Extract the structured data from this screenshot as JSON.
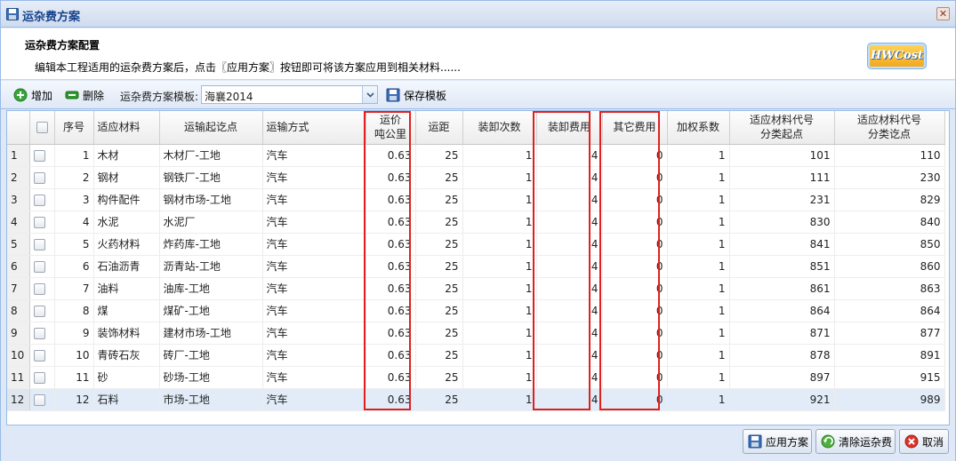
{
  "window": {
    "title": "运杂费方案",
    "close_symbol": "✕"
  },
  "header": {
    "title": "运杂费方案配置",
    "description": "编辑本工程适用的运杂费方案后，点击〖应用方案〗按钮即可将该方案应用到相关材料......",
    "logo": "HWCost"
  },
  "toolbar": {
    "add_label": "增加",
    "delete_label": "删除",
    "template_label": "运杂费方案模板:",
    "template_value": "海襄2014",
    "save_template_label": "保存模板"
  },
  "grid": {
    "columns": {
      "seq": "序号",
      "material": "适应材料",
      "route": "运输起讫点",
      "mode": "运输方式",
      "price_l1": "运价",
      "price_l2": "吨公里",
      "distance": "运距",
      "load_times": "装卸次数",
      "load_fee": "装卸费用",
      "other_fee": "其它费用",
      "weight": "加权系数",
      "code_start_l1": "适应材料代号",
      "code_start_l2": "分类起点",
      "code_end_l1": "适应材料代号",
      "code_end_l2": "分类讫点"
    },
    "rows": [
      {
        "rn": "1",
        "seq": "1",
        "material": "木材",
        "route": "木材厂-工地",
        "mode": "汽车",
        "price": "0.63",
        "distance": "25",
        "load_times": "1",
        "load_fee": "4",
        "other_fee": "0",
        "weight": "1",
        "code_start": "101",
        "code_end": "110"
      },
      {
        "rn": "2",
        "seq": "2",
        "material": "钢材",
        "route": "钢铁厂-工地",
        "mode": "汽车",
        "price": "0.63",
        "distance": "25",
        "load_times": "1",
        "load_fee": "4",
        "other_fee": "0",
        "weight": "1",
        "code_start": "111",
        "code_end": "230"
      },
      {
        "rn": "3",
        "seq": "3",
        "material": "构件配件",
        "route": "钢材市场-工地",
        "mode": "汽车",
        "price": "0.63",
        "distance": "25",
        "load_times": "1",
        "load_fee": "4",
        "other_fee": "0",
        "weight": "1",
        "code_start": "231",
        "code_end": "829"
      },
      {
        "rn": "4",
        "seq": "4",
        "material": "水泥",
        "route": "水泥厂",
        "mode": "汽车",
        "price": "0.63",
        "distance": "25",
        "load_times": "1",
        "load_fee": "4",
        "other_fee": "0",
        "weight": "1",
        "code_start": "830",
        "code_end": "840"
      },
      {
        "rn": "5",
        "seq": "5",
        "material": "火药材料",
        "route": "炸药库-工地",
        "mode": "汽车",
        "price": "0.63",
        "distance": "25",
        "load_times": "1",
        "load_fee": "4",
        "other_fee": "0",
        "weight": "1",
        "code_start": "841",
        "code_end": "850"
      },
      {
        "rn": "6",
        "seq": "6",
        "material": "石油沥青",
        "route": "沥青站-工地",
        "mode": "汽车",
        "price": "0.63",
        "distance": "25",
        "load_times": "1",
        "load_fee": "4",
        "other_fee": "0",
        "weight": "1",
        "code_start": "851",
        "code_end": "860"
      },
      {
        "rn": "7",
        "seq": "7",
        "material": "油料",
        "route": "油库-工地",
        "mode": "汽车",
        "price": "0.63",
        "distance": "25",
        "load_times": "1",
        "load_fee": "4",
        "other_fee": "0",
        "weight": "1",
        "code_start": "861",
        "code_end": "863"
      },
      {
        "rn": "8",
        "seq": "8",
        "material": "煤",
        "route": "煤矿-工地",
        "mode": "汽车",
        "price": "0.63",
        "distance": "25",
        "load_times": "1",
        "load_fee": "4",
        "other_fee": "0",
        "weight": "1",
        "code_start": "864",
        "code_end": "864"
      },
      {
        "rn": "9",
        "seq": "9",
        "material": "装饰材料",
        "route": "建材市场-工地",
        "mode": "汽车",
        "price": "0.63",
        "distance": "25",
        "load_times": "1",
        "load_fee": "4",
        "other_fee": "0",
        "weight": "1",
        "code_start": "871",
        "code_end": "877"
      },
      {
        "rn": "10",
        "seq": "10",
        "material": "青砖石灰",
        "route": "砖厂-工地",
        "mode": "汽车",
        "price": "0.63",
        "distance": "25",
        "load_times": "1",
        "load_fee": "4",
        "other_fee": "0",
        "weight": "1",
        "code_start": "878",
        "code_end": "891"
      },
      {
        "rn": "11",
        "seq": "11",
        "material": "砂",
        "route": "砂场-工地",
        "mode": "汽车",
        "price": "0.63",
        "distance": "25",
        "load_times": "1",
        "load_fee": "4",
        "other_fee": "0",
        "weight": "1",
        "code_start": "897",
        "code_end": "915"
      },
      {
        "rn": "12",
        "seq": "12",
        "material": "石料",
        "route": "市场-工地",
        "mode": "汽车",
        "price": "0.63",
        "distance": "25",
        "load_times": "1",
        "load_fee": "4",
        "other_fee": "0",
        "weight": "1",
        "code_start": "921",
        "code_end": "989"
      }
    ]
  },
  "footer": {
    "apply_label": "应用方案",
    "clear_label": "清除运杂费",
    "cancel_label": "取消"
  },
  "colors": {
    "highlight_box": "#e02020",
    "border": "#99bbe8",
    "title": "#15428b"
  }
}
